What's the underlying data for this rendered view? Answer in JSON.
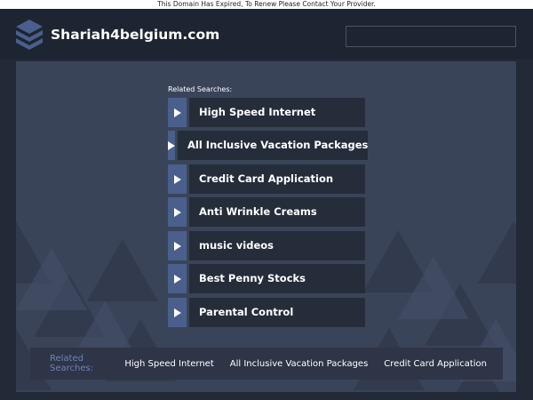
{
  "notice": "This Domain Has Expired, To Renew Please Contact Your Provider.",
  "header": {
    "site_title": "Shariah4belgium.com",
    "logo_icon": "stacked-layers-icon",
    "search_value": ""
  },
  "main": {
    "related_label": "Related Searches:",
    "links": [
      "High Speed Internet",
      "All Inclusive Vacation Packages",
      "Credit Card Application",
      "Anti Wrinkle Creams",
      "music videos",
      "Best Penny Stocks",
      "Parental Control"
    ]
  },
  "footer": {
    "label": "Related Searches:",
    "links": [
      "High Speed Internet",
      "All Inclusive Vacation Packages",
      "Credit Card Application"
    ]
  },
  "colors": {
    "background": "#222a38",
    "panel": "#3a4459",
    "arrow_accent": "#4a5f8c",
    "link_bg": "#252d3b",
    "footer_label": "#6c85b8"
  }
}
